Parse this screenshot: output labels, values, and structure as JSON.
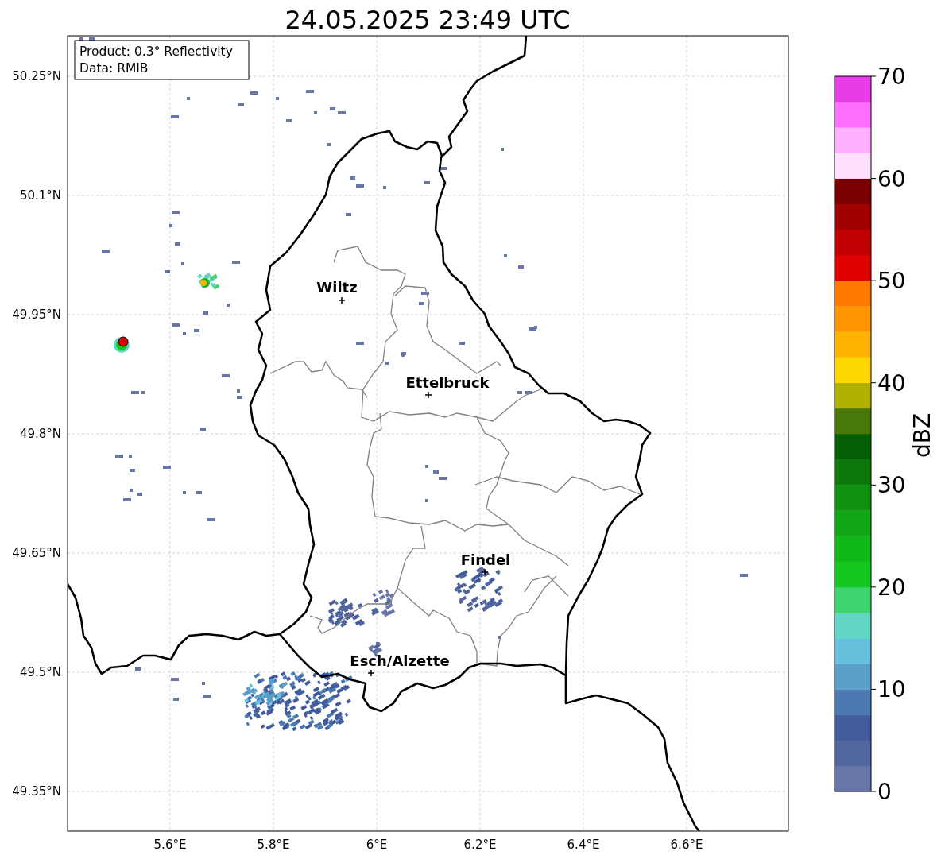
{
  "title": "24.05.2025 23:49 UTC",
  "info_box": [
    "Product: 0.3° Reflectivity",
    "Data: RMIB"
  ],
  "map": {
    "lat_ticks": [
      "50.25°N",
      "50.1°N",
      "49.95°N",
      "49.8°N",
      "49.65°N",
      "49.5°N",
      "49.35°N"
    ],
    "lon_ticks": [
      "5.6°E",
      "5.8°E",
      "6°E",
      "6.2°E",
      "6.4°E",
      "6.6°E"
    ],
    "cities": [
      {
        "name": "Wiltz"
      },
      {
        "name": "Ettelbruck"
      },
      {
        "name": "Findel"
      },
      {
        "name": "Esch/Alzette"
      }
    ]
  },
  "colorbar": {
    "label": "dBZ",
    "ticks": [
      "70",
      "60",
      "50",
      "40",
      "30",
      "20",
      "10",
      "0"
    ],
    "colors": [
      {
        "color": "#6676a8"
      },
      {
        "color": "#52669e"
      },
      {
        "color": "#425c9e"
      },
      {
        "color": "#4a7ab0"
      },
      {
        "color": "#5a9fc8"
      },
      {
        "color": "#64c0dc"
      },
      {
        "color": "#62d6c4"
      },
      {
        "color": "#3dd470"
      },
      {
        "color": "#12c81c"
      },
      {
        "color": "#10b818"
      },
      {
        "color": "#10a614"
      },
      {
        "color": "#0e9210"
      },
      {
        "color": "#0c780c"
      },
      {
        "color": "#045e04"
      },
      {
        "color": "#487808"
      },
      {
        "color": "#b0b000"
      },
      {
        "color": "#ffd700"
      },
      {
        "color": "#ffb400"
      },
      {
        "color": "#ff9600"
      },
      {
        "color": "#ff7800"
      },
      {
        "color": "#e00000"
      },
      {
        "color": "#c00000"
      },
      {
        "color": "#a00000"
      },
      {
        "color": "#7a0000"
      },
      {
        "color": "#ffe0ff"
      },
      {
        "color": "#ffb0ff"
      },
      {
        "color": "#ff6eff"
      },
      {
        "color": "#e83ce8"
      }
    ]
  }
}
